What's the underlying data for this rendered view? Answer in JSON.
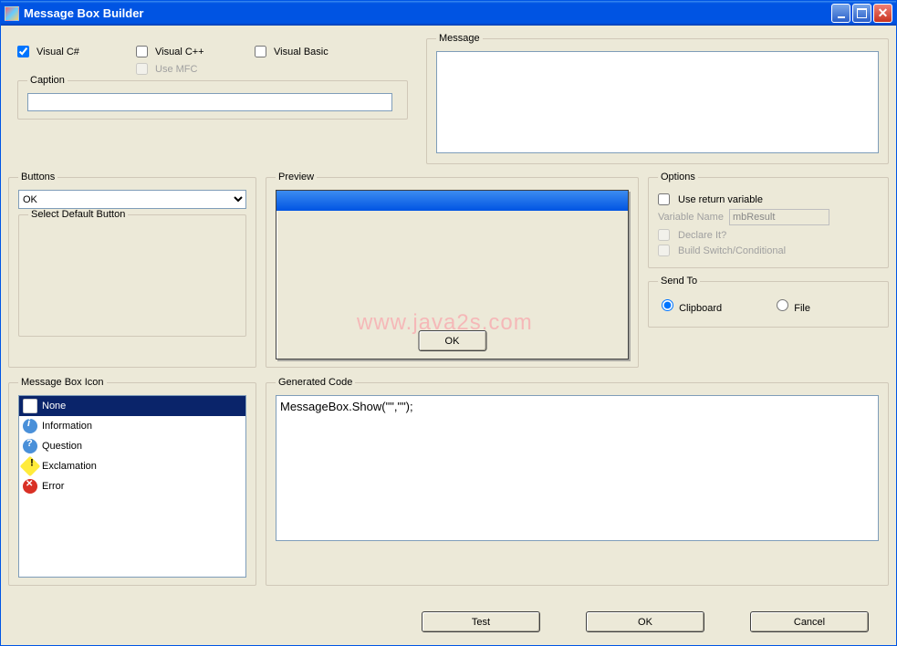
{
  "window": {
    "title": "Message Box Builder"
  },
  "lang": {
    "csharp": "Visual C#",
    "cpp": "Visual C++",
    "vb": "Visual Basic",
    "use_mfc": "Use MFC"
  },
  "caption": {
    "legend": "Caption",
    "value": ""
  },
  "message": {
    "legend": "Message",
    "value": ""
  },
  "buttons": {
    "legend": "Buttons",
    "selected": "OK",
    "default_legend": "Select Default Button"
  },
  "preview": {
    "legend": "Preview",
    "ok": "OK"
  },
  "options": {
    "legend": "Options",
    "use_return": "Use return variable",
    "var_name_label": "Variable Name",
    "var_name_value": "mbResult",
    "declare": "Declare It?",
    "build_switch": "Build Switch/Conditional"
  },
  "sendto": {
    "legend": "Send To",
    "clipboard": "Clipboard",
    "file": "File"
  },
  "icons": {
    "legend": "Message Box Icon",
    "items": [
      "None",
      "Information",
      "Question",
      "Exclamation",
      "Error"
    ]
  },
  "gen": {
    "legend": "Generated Code",
    "code": "MessageBox.Show(\"\",\"\");"
  },
  "actions": {
    "test": "Test",
    "ok": "OK",
    "cancel": "Cancel"
  },
  "watermark": "www.java2s.com"
}
